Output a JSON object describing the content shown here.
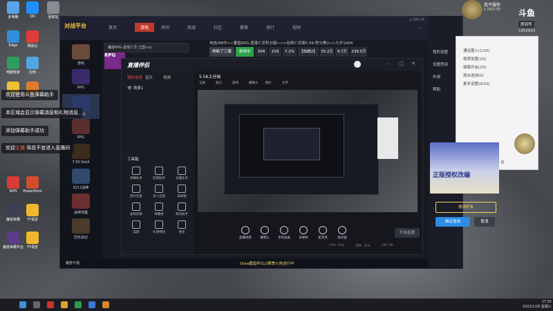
{
  "desktop": {
    "icons": [
      {
        "label": "此电脑",
        "color": "#5aa3e8"
      },
      {
        "label": "QQ",
        "color": "#1e90ff"
      },
      {
        "label": "回收站",
        "color": "#888c93"
      },
      {
        "label": "Edge",
        "color": "#2f8fd8"
      },
      {
        "label": "网易云",
        "color": "#e03a3a"
      },
      {
        "label": "电脑管家",
        "color": "#2f9e5c"
      },
      {
        "label": "应用",
        "color": "#4fa6e0"
      },
      {
        "label": "QQ音乐",
        "color": "#f2c230"
      },
      {
        "label": "游戏",
        "color": "#e07b2e"
      },
      {
        "label": "WPS",
        "color": "#d93b36"
      },
      {
        "label": "PowerPoint",
        "color": "#d24d2a"
      },
      {
        "label": "魔兽争霸",
        "color": "#3d3f55"
      },
      {
        "label": "YY语音",
        "color": "#f2b72c"
      },
      {
        "label": "魔兽争霸平台",
        "color": "#5b3b8a"
      },
      {
        "label": "YY语音",
        "color": "#f2b72c"
      }
    ]
  },
  "toasts": [
    {
      "text": "欢迎使用斗鱼弹幕助手"
    },
    {
      "text": "本区域会显示弹幕消息和礼物消息"
    },
    {
      "text": "添加弹幕助手成功"
    },
    {
      "pre": "欢迎",
      "user": "主播",
      "post": " 驾花不宣进入直播间"
    }
  ],
  "app": {
    "logo": "对战平台",
    "tabs": [
      "首页",
      "游戏",
      "房间",
      "商城",
      "社区",
      "赛事",
      "排行",
      "视频"
    ],
    "active_tab": "游戏",
    "version": "2.025.41",
    "side_items": [
      {
        "label": "游戏",
        "color": "#6b4a3a"
      },
      {
        "label": "RPG",
        "color": "#3a2a6b"
      },
      {
        "label": "War3",
        "color": "#2b3a6a"
      },
      {
        "label": "RPG",
        "color": "#5a2f2f"
      },
      {
        "label": "7.00 DotA",
        "color": "#3c2c1c"
      },
      {
        "label": "9211战神",
        "color": "#2f4a6b"
      },
      {
        "label": "战神觉醒",
        "color": "#6b2f2f"
      },
      {
        "label": "异形战记",
        "color": "#4a3a2a"
      }
    ],
    "room_bar": "魔兽RPG-遗落亡灵-王国-ccc",
    "room_title": "电信/88中>>魔兽RPG-遗落亡灵积分版>>>经典亡灵版5.56-积分赛2>>大岁1004",
    "stats": [
      {
        "text": "刷新了三服",
        "color": "#3a3d48"
      },
      {
        "text": "游戏中",
        "color": "#2ea14d"
      },
      {
        "text": "304",
        "color": "#2a2d38"
      },
      {
        "text": "219",
        "color": "#2a2d38"
      },
      {
        "text": "7.2%",
        "color": "#2a2d38"
      },
      {
        "text": "【血统2】",
        "color": "#2a2d38"
      },
      {
        "text": "15.2万",
        "color": "#2a2d38"
      },
      {
        "text": "9.7万",
        "color": "#2a2d38"
      },
      {
        "text": "239.0万",
        "color": "#2a2d38"
      }
    ],
    "status_text": "Dota魔兽杯S12赛季火热进行中",
    "bottom_user": "魔兽不语"
  },
  "companion": {
    "title": "直播伴侣",
    "nav": [
      "我的场景",
      "音乐",
      "视频"
    ],
    "scene": "场景1",
    "game_name": "5.56上分局",
    "tools": [
      "全屏",
      "窗口",
      "游戏",
      "摄像头",
      "图片",
      "文字"
    ],
    "toolbox_title": "工具箱",
    "toolbox": [
      "弹幕助手",
      "房管助手",
      "主播任务",
      "观众连麦",
      "多人连麦",
      "录屏器",
      "虚拟形象",
      "弹幕姬",
      "歌词助手",
      "美颜",
      "礼物特效",
      "更多"
    ],
    "bottom_tools": [
      "直播场景",
      "摄像头",
      "手机投屏",
      "多媒体",
      "麦克风",
      "扬声器"
    ],
    "live_btn": "开始直播",
    "perf": [
      "CPU: 22%",
      "内存: 35%",
      "FPS: 60"
    ]
  },
  "right": {
    "name": "我不服你",
    "sub": "1.50/3.00",
    "brand": "斗鱼",
    "room_label": "房间号",
    "room_no": "1850865",
    "menu": [
      "我的设置",
      "设置房间",
      "外观",
      "帮助"
    ],
    "popup": [
      "通话置入(1/10)",
      "视频设置(10)",
      "弹幕开启(10)",
      "观众连线(0)",
      "更多设置(0/10)"
    ],
    "banner": "正版授权改编",
    "invite_btn": "邀请好友",
    "confirm_btn": "确定邀请",
    "cancel_btn": "取消"
  },
  "taskbar": {
    "time": "17:55",
    "date": "2022/1/26 星期三"
  }
}
